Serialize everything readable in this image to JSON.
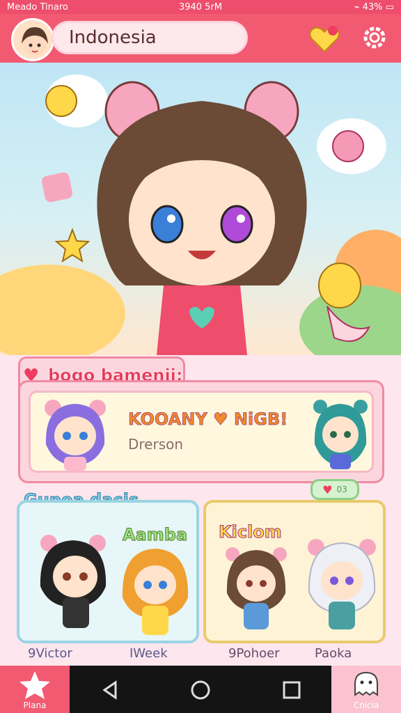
{
  "status_bar": {
    "carrier": "Meado Tinaro",
    "time": "3940 5rM",
    "battery": "43%"
  },
  "header": {
    "search_text": "Indonesia"
  },
  "section1": {
    "title": "bogo bamenii:",
    "banner_title": "KOOANY ♥ NiGB!",
    "banner_subtitle": "Drerson"
  },
  "pill": {
    "label": "03"
  },
  "section2": {
    "title": "Gupoa dacis"
  },
  "cards": [
    {
      "name": "Aamba",
      "caption": "9Victor"
    },
    {
      "name": "Kiclom",
      "caption": "9Pohoer"
    }
  ],
  "captions_extra": {
    "left2": "IWeek",
    "right2": "Paoka"
  },
  "nav": {
    "left_label": "Plana",
    "right_label": "Cnicia"
  },
  "colors": {
    "primary": "#f25a72",
    "accent_pink": "#fbd6df",
    "cyan": "#7ecfe6",
    "yellow": "#e8ca6b"
  },
  "icons": [
    "wifi-icon",
    "battery-icon",
    "heart-icon",
    "gear-icon",
    "star-icon",
    "back-icon",
    "home-icon",
    "recents-icon",
    "ghost-icon"
  ]
}
